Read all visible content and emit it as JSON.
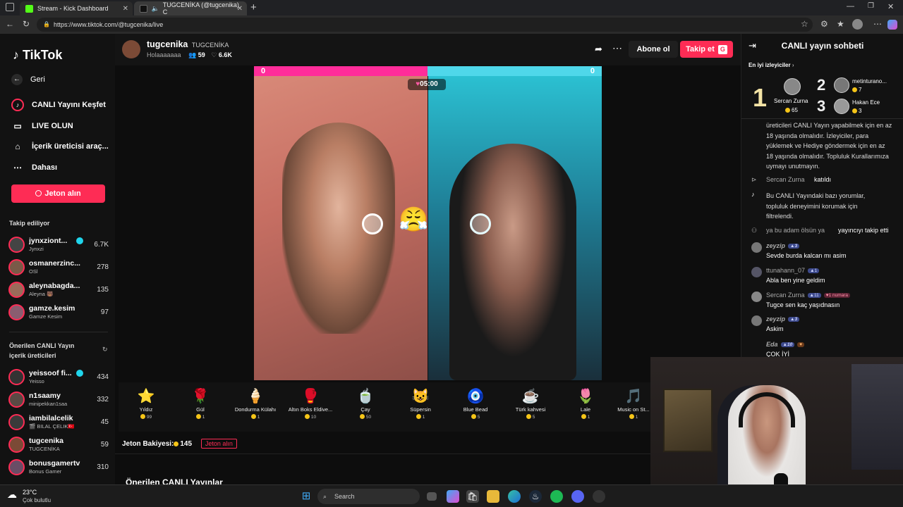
{
  "browser": {
    "tabs": [
      {
        "title": "Stream - Kick Dashboard",
        "favicon_color": "#53fc18"
      },
      {
        "title": "TUGCENİKA (@tugcenika) C",
        "favicon_color": "#000000"
      }
    ],
    "url": "https://www.tiktok.com/@tugcenika/live"
  },
  "sidebar": {
    "logo": "TikTok",
    "nav": [
      {
        "label": "Geri",
        "icon": "back-arrow-icon"
      },
      {
        "label": "CANLI Yayını Keşfet",
        "icon": "live-explore-icon"
      },
      {
        "label": "LIVE OLUN",
        "icon": "video-camera-icon"
      },
      {
        "label": "İçerik üreticisi araç...",
        "icon": "home-icon"
      },
      {
        "label": "Dahası",
        "icon": "more-dots-icon"
      }
    ],
    "coins_button": "Jeton alın",
    "following_title": "Takip ediliyor",
    "following": [
      {
        "name": "jynxziont...",
        "sub": "Jynxzi",
        "count": "6.7K",
        "verified": true
      },
      {
        "name": "osmanerzinc...",
        "sub": "OSl",
        "count": "278"
      },
      {
        "name": "aleynabagda...",
        "sub": "Aleyna 🐻",
        "count": "135"
      },
      {
        "name": "gamze.kesim",
        "sub": "Gamze Kesim",
        "count": "97"
      }
    ],
    "suggested_title": "Önerilen CANLI Yayın içerik üreticileri",
    "suggested": [
      {
        "name": "yeissoof fi...",
        "sub": "Yeisso",
        "count": "434",
        "verified": true
      },
      {
        "name": "n1saamy",
        "sub": "minipekkan1saa",
        "count": "332"
      },
      {
        "name": "iambilalcelik",
        "sub": "🎬 BILAL ÇELIK🇹🇷",
        "count": "45"
      },
      {
        "name": "tugcenika",
        "sub": "TUGCENİKA",
        "count": "59"
      },
      {
        "name": "bonusgamertv",
        "sub": "Bonus Gamer",
        "count": "310"
      }
    ]
  },
  "stream": {
    "host_name": "tugcenika",
    "host_display": "TUGCENİKA",
    "host_status": "Holaaaaaaa",
    "viewers": "59",
    "likes": "6.6K",
    "subscribe_label": "Abone ol",
    "follow_label": "Takip et",
    "follow_badge": "G",
    "battle": {
      "left_score": "0",
      "right_score": "0",
      "timer": "05:00"
    }
  },
  "gifts": [
    {
      "name": "Yıldız",
      "price": "99",
      "icon": "⭐"
    },
    {
      "name": "Gül",
      "price": "1",
      "icon": "🌹"
    },
    {
      "name": "Dondurma Külahı",
      "price": "1",
      "icon": "🍦"
    },
    {
      "name": "Altın Boks Eldive...",
      "price": "10",
      "icon": "🥊"
    },
    {
      "name": "Çay",
      "price": "50",
      "icon": "🍵"
    },
    {
      "name": "Süpersin",
      "price": "1",
      "icon": "😺"
    },
    {
      "name": "Blue Bead",
      "price": "5",
      "icon": "🧿"
    },
    {
      "name": "Türk kahvesi",
      "price": "5",
      "icon": "☕"
    },
    {
      "name": "Lale",
      "price": "1",
      "icon": "🌷"
    },
    {
      "name": "Music on St...",
      "price": "1",
      "icon": "🎵"
    }
  ],
  "balance": {
    "label": "Jeton Bakiyesi:",
    "value": "145",
    "button": "Jeton alın"
  },
  "recommended_title": "Önerilen CANLI Yayınlar",
  "chat": {
    "title": "CANLI yayın sohbeti",
    "top_viewers_label": "En iyi izleyiciler",
    "top_viewers": [
      {
        "rank": "1",
        "name": "Sercan Zurna",
        "coins": "65"
      },
      {
        "rank": "2",
        "name": "metinturano...",
        "coins": "7"
      },
      {
        "rank": "3",
        "name": "Hakan Ece",
        "coins": "3"
      }
    ],
    "notice": "üreticileri CANLI Yayın yapabilmek için en az 18 yaşında olmalıdır. İzleyiciler, para yüklemek ve Hediye göndermek için en az 18 yaşında olmalıdır. Topluluk Kurallarımıza uymayı unutmayın.",
    "messages": [
      {
        "user": "Sercan Zurna",
        "text": "katıldı",
        "type": "system"
      },
      {
        "user": "",
        "text": "Bu CANLI Yayındaki bazı yorumlar, topluluk deneyimini korumak için filtrelendi.",
        "type": "system"
      },
      {
        "user": "ya bu adam ölsün ya",
        "text": "yayıncıyı takip etti",
        "type": "system"
      },
      {
        "user": "zeyzip",
        "badge": "3",
        "text": "Sevde burda kalcan mı asim"
      },
      {
        "user": "ttunahann_07",
        "badge": "1",
        "text": "Abla ben yine geldim"
      },
      {
        "user": "Sercan Zurna",
        "badge": "11",
        "extra_badge": "1 numara",
        "text": "Tugce sen kaç yaşıdnasın"
      },
      {
        "user": "zeyzip",
        "badge": "3",
        "text": "Askim"
      },
      {
        "user": "Eda",
        "badge": "10",
        "text": "ÇOK İYİ"
      }
    ]
  },
  "taskbar": {
    "weather_temp": "23°C",
    "weather_desc": "Çok bulutlu",
    "search_placeholder": "Search"
  }
}
